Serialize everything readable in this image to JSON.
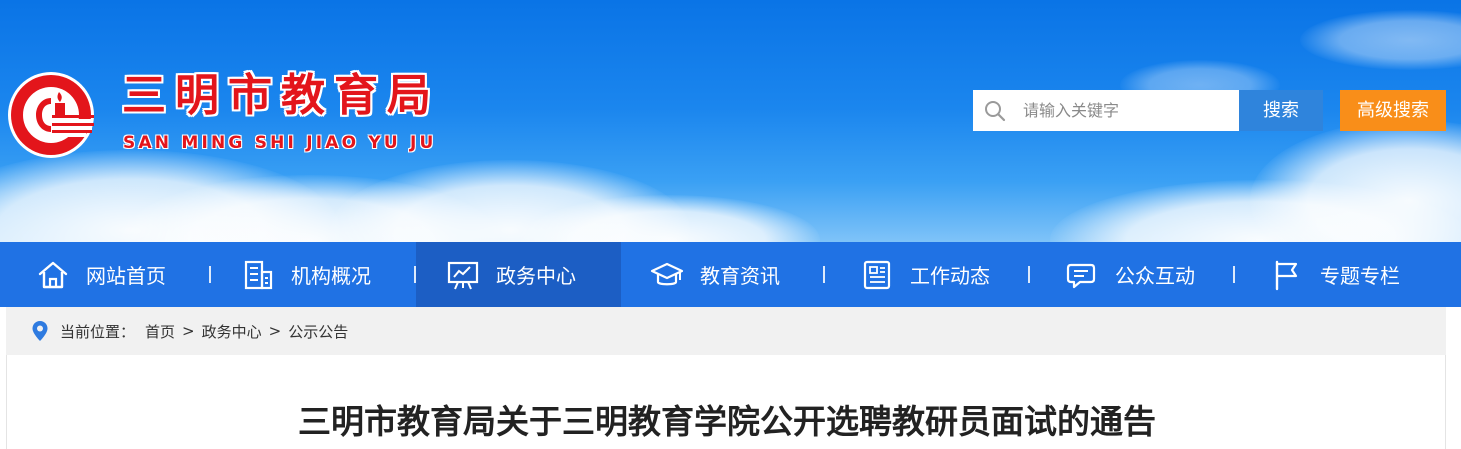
{
  "site": {
    "title": "三明市教育局",
    "pinyin": "SAN MING SHI JIAO YU JU"
  },
  "search": {
    "placeholder": "请输入关键字",
    "value": "",
    "search_label": "搜索",
    "advanced_label": "高级搜索"
  },
  "nav": {
    "items": [
      {
        "label": "网站首页",
        "icon": "home-icon"
      },
      {
        "label": "机构概况",
        "icon": "building-icon"
      },
      {
        "label": "政务中心",
        "icon": "presentation-board-icon",
        "active": true
      },
      {
        "label": "教育资讯",
        "icon": "graduation-cap-icon"
      },
      {
        "label": "工作动态",
        "icon": "newspaper-icon"
      },
      {
        "label": "公众互动",
        "icon": "chat-bubbles-icon"
      },
      {
        "label": "专题专栏",
        "icon": "flag-icon"
      }
    ]
  },
  "breadcrumb": {
    "prefix": "当前位置：",
    "items": [
      "首页",
      "政务中心",
      "公示公告"
    ],
    "separator": ">"
  },
  "article": {
    "title": "三明市教育局关于三明教育学院公开选聘教研员面试的通告"
  },
  "colors": {
    "nav_bg": "#2072e4",
    "nav_active": "#1c5ec4",
    "brand_red": "#e3151b",
    "search_button": "#2f84dc",
    "advanced_button": "#f98e19"
  }
}
